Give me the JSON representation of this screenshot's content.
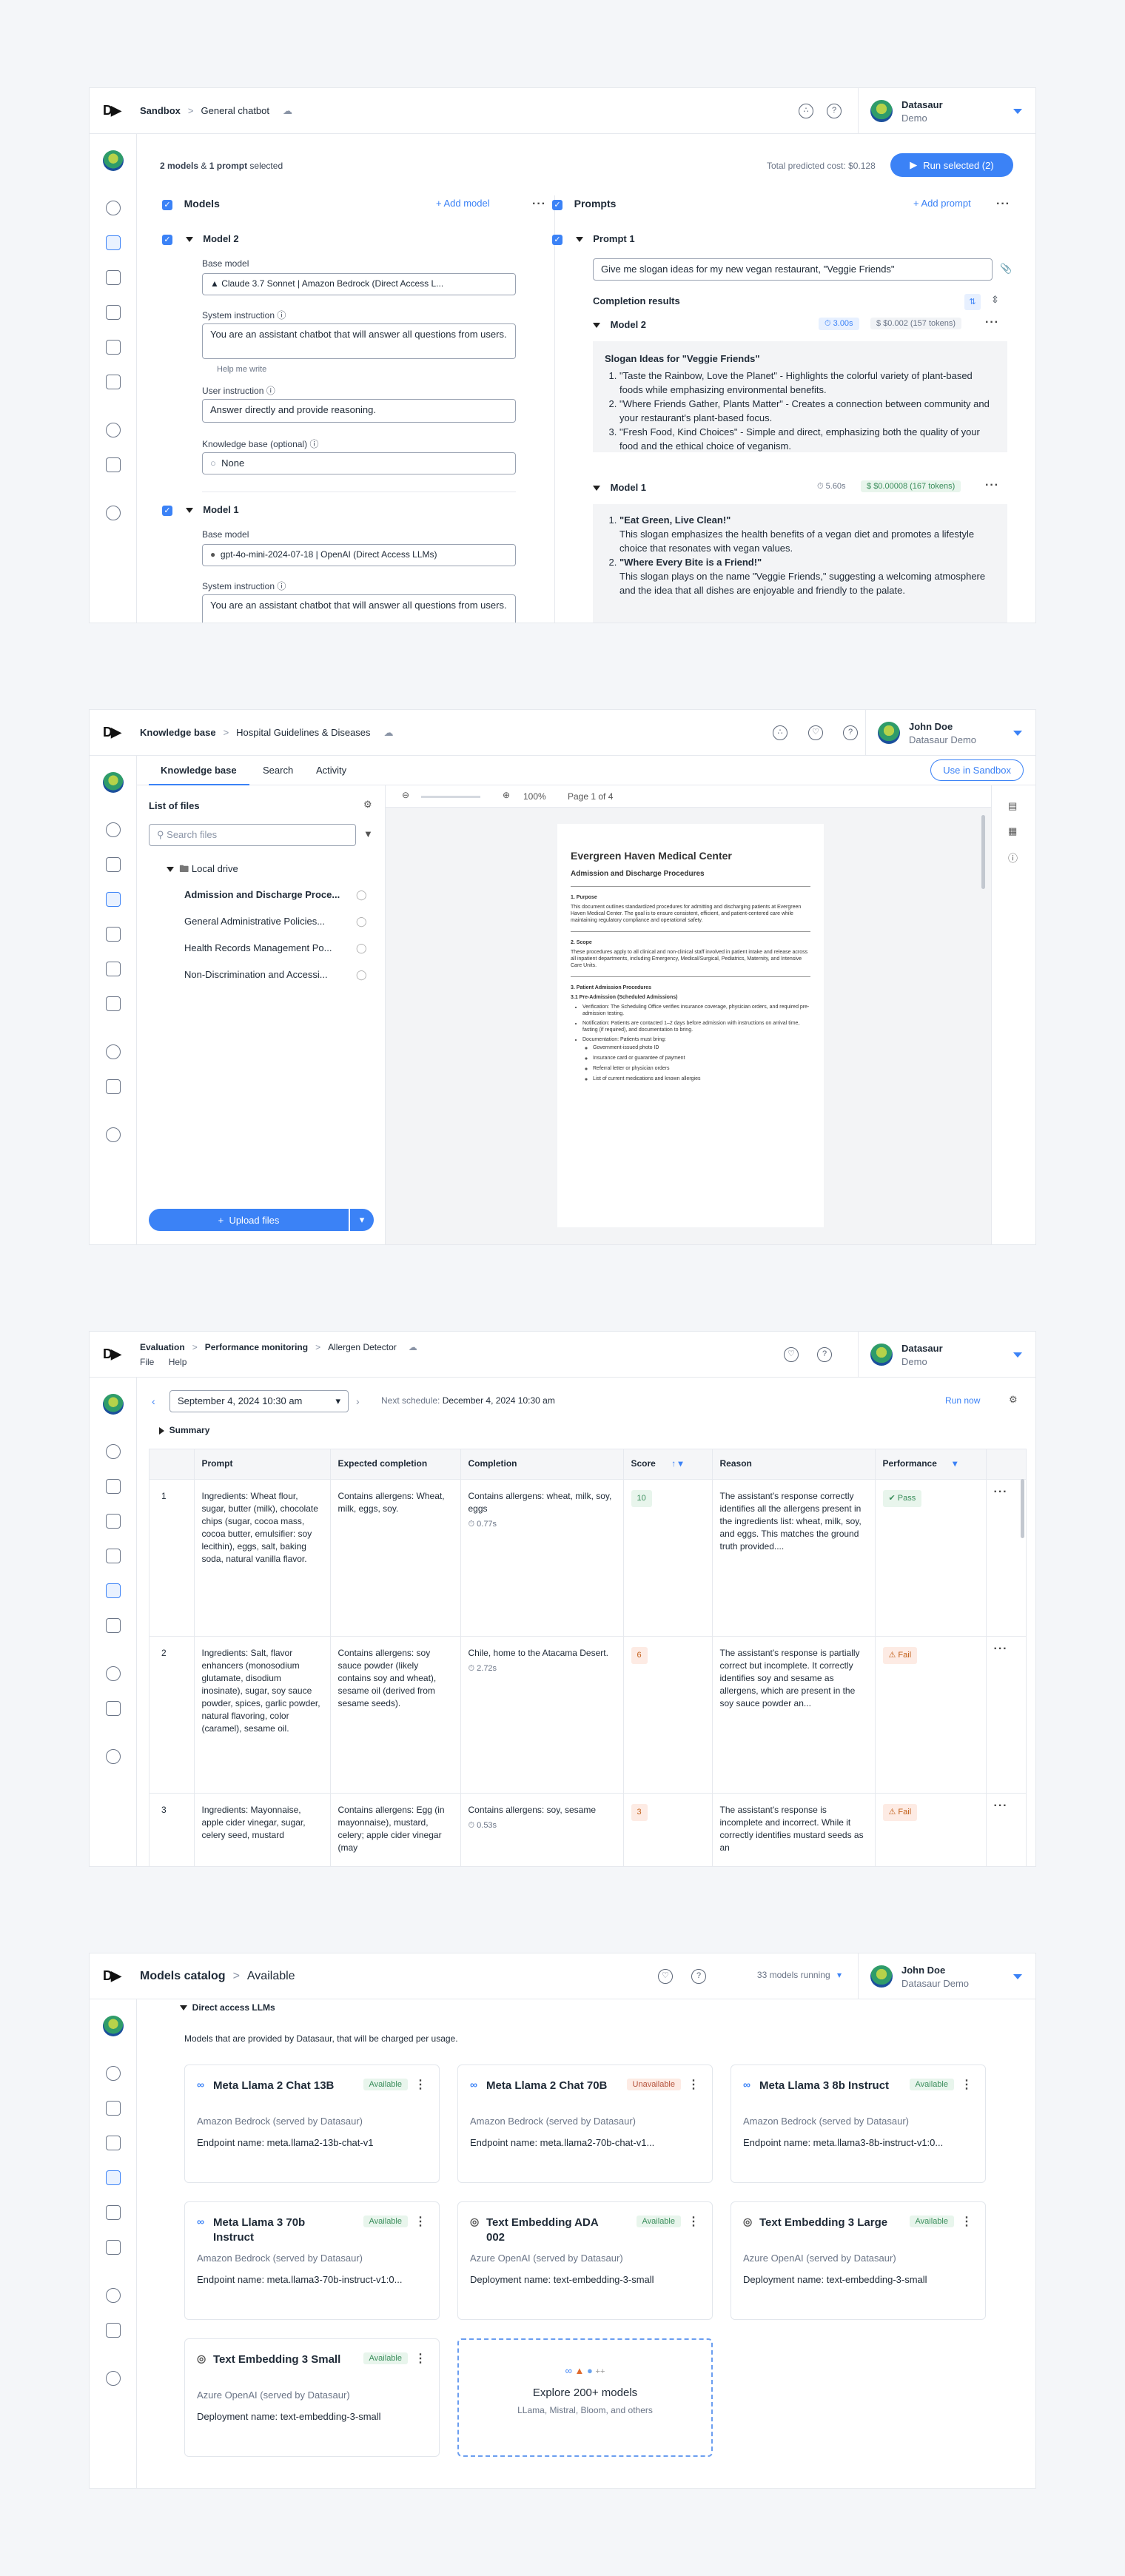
{
  "colors": {
    "accent": "#3b82f6",
    "pass": "#3a8d5b",
    "fail": "#c2601a"
  },
  "sandbox": {
    "breadcrumb": [
      "Sandbox",
      "General chatbot"
    ],
    "user": {
      "name": "Datasaur",
      "sub": "Demo"
    },
    "summary": {
      "models": "2 models",
      "amp": "&",
      "prompts": "1 prompt",
      "selected": "selected"
    },
    "cost_label": "Total predicted cost:",
    "cost_value": "$0.128",
    "run_button": "Run selected (2)",
    "models_header": "Models",
    "add_model": "+ Add model",
    "prompts_header": "Prompts",
    "add_prompt": "+ Add prompt",
    "model2": {
      "title": "Model 2",
      "base_label": "Base model",
      "base_value": "Claude 3.7 Sonnet | Amazon Bedrock (Direct Access L...",
      "sys_label": "System instruction",
      "sys_value": "You are an assistant chatbot that will answer all questions from users.",
      "help": "Help me write",
      "user_label": "User instruction",
      "user_value": "Answer directly and provide reasoning.",
      "kb_label": "Knowledge base (optional)",
      "kb_value": "None"
    },
    "model1": {
      "title": "Model 1",
      "base_label": "Base model",
      "base_value": "gpt-4o-mini-2024-07-18 | OpenAI (Direct Access LLMs)",
      "sys_label": "System instruction",
      "sys_value": "You are an assistant chatbot that will answer all questions from users."
    },
    "prompt1": {
      "title": "Prompt 1",
      "value": "Give me slogan ideas for my new vegan restaurant, \"Veggie Friends\""
    },
    "completion_results": "Completion results",
    "result2": {
      "title": "Model 2",
      "time": "3.00s",
      "cost": "$0.002 (157 tokens)",
      "heading": "Slogan Ideas for \"Veggie Friends\"",
      "items": [
        "\"Taste the Rainbow, Love the Planet\" - Highlights the colorful variety of plant-based foods while emphasizing environmental benefits.",
        "\"Where Friends Gather, Plants Matter\" - Creates a connection between community and your restaurant's plant-based focus.",
        "\"Fresh Food, Kind Choices\" - Simple and direct, emphasizing both the quality of your food and the ethical choice of veganism."
      ]
    },
    "result1": {
      "title": "Model 1",
      "time": "5.60s",
      "cost": "$0.00008 (167 tokens)",
      "items": [
        {
          "h": "\"Eat Green, Live Clean!\"",
          "d": "This slogan emphasizes the health benefits of a vegan diet and promotes a lifestyle choice that resonates with vegan values."
        },
        {
          "h": "\"Where Every Bite is a Friend!\"",
          "d": "This slogan plays on the name \"Veggie Friends,\" suggesting a welcoming atmosphere and the idea that all dishes are enjoyable and friendly to the palate."
        }
      ]
    }
  },
  "kb": {
    "breadcrumb": [
      "Knowledge base",
      "Hospital Guidelines & Diseases"
    ],
    "user": {
      "name": "John Doe",
      "sub": "Datasaur Demo"
    },
    "tabs": [
      "Knowledge base",
      "Search",
      "Activity"
    ],
    "sandbox_button": "Use in Sandbox",
    "list_title": "List of files",
    "search_placeholder": "Search files",
    "folder": "Local drive",
    "files": [
      "Admission and Discharge Proce...",
      "General Administrative Policies...",
      "Health Records Management Po...",
      "Non-Discrimination and Accessi..."
    ],
    "upload": "Upload files",
    "zoom": "100%",
    "page": "Page 1 of 4",
    "doc": {
      "title": "Evergreen Haven Medical Center",
      "subtitle": "Admission and Discharge Procedures",
      "s1": "1. Purpose",
      "s1t": "This document outlines standardized procedures for admitting and discharging patients at Evergreen Haven Medical Center. The goal is to ensure consistent, efficient, and patient-centered care while maintaining regulatory compliance and operational safety.",
      "s2": "2. Scope",
      "s2t": "These procedures apply to all clinical and non-clinical staff involved in patient intake and release across all inpatient departments, including Emergency, Medical/Surgical, Pediatrics, Maternity, and Intensive Care Units.",
      "s3": "3. Patient Admission Procedures",
      "s31": "3.1 Pre-Admission (Scheduled Admissions)",
      "b1": "Verification: The Scheduling Office verifies insurance coverage, physician orders, and required pre-admission testing.",
      "b2": "Notification: Patients are contacted 1–2 days before admission with instructions on arrival time, fasting (if required), and documentation to bring.",
      "b3": "Documentation: Patients must bring:",
      "sub": [
        "Government-issued photo ID",
        "Insurance card or guarantee of payment",
        "Referral letter or physician orders",
        "List of current medications and known allergies"
      ]
    }
  },
  "eval": {
    "breadcrumb": [
      "Evaluation",
      "Performance monitoring",
      "Allergen Detector"
    ],
    "menu": [
      "File",
      "Help"
    ],
    "user": {
      "name": "Datasaur",
      "sub": "Demo"
    },
    "date": "September 4, 2024 10:30 am",
    "next_label": "Next schedule:",
    "next_value": "December 4, 2024 10:30 am",
    "run_now": "Run now",
    "summary": "Summary",
    "columns": [
      "Prompt",
      "Expected completion",
      "Completion",
      "Score",
      "Reason",
      "Performance"
    ],
    "rows": [
      {
        "n": "1",
        "prompt": "Ingredients: Wheat flour, sugar, butter (milk), chocolate chips (sugar, cocoa mass, cocoa butter, emulsifier: soy lecithin), eggs, salt, baking soda, natural vanilla flavor.",
        "expected": "Contains allergens: Wheat, milk, eggs, soy.",
        "completion": "Contains allergens: wheat, milk, soy, eggs",
        "time": "0.77s",
        "score": "10",
        "reason": "The assistant's response correctly identifies all the allergens present in the ingredients list: wheat, milk, soy, and eggs. This matches the ground truth provided....",
        "perf": "Pass"
      },
      {
        "n": "2",
        "prompt": "Ingredients: Salt, flavor enhancers (monosodium glutamate, disodium inosinate), sugar, soy sauce powder, spices, garlic powder, natural flavoring, color (caramel), sesame oil.",
        "expected": "Contains allergens: soy sauce powder (likely contains soy and wheat), sesame oil (derived from sesame seeds).",
        "completion": "Chile, home to the Atacama Desert.",
        "time": "2.72s",
        "score": "6",
        "reason": "The assistant's response is partially correct but incomplete. It correctly identifies soy and sesame as allergens, which are present in the soy sauce powder an...",
        "perf": "Fail"
      },
      {
        "n": "3",
        "prompt": "Ingredients: Mayonnaise, apple cider vinegar, sugar, celery seed, mustard",
        "expected": "Contains allergens: Egg (in mayonnaise), mustard, celery; apple cider vinegar (may",
        "completion": "Contains allergens: soy, sesame",
        "time": "0.53s",
        "score": "3",
        "reason": "The assistant's response is incomplete and incorrect. While it correctly identifies mustard seeds as an",
        "perf": "Fail"
      }
    ]
  },
  "catalog": {
    "breadcrumb": [
      "Models catalog",
      "Available"
    ],
    "user": {
      "name": "John Doe",
      "sub": "Datasaur Demo"
    },
    "running": "33 models running",
    "section": "Direct access LLMs",
    "desc": "Models that are provided by Datasaur, that will be charged per usage.",
    "models": [
      {
        "name": "Meta Llama 2 Chat 13B",
        "status": "Available",
        "provider": "Amazon Bedrock (served by Datasaur)",
        "endpoint": "Endpoint name: meta.llama2-13b-chat-v1"
      },
      {
        "name": "Meta Llama 2 Chat 70B",
        "status": "Unavailable",
        "provider": "Amazon Bedrock (served by Datasaur)",
        "endpoint": "Endpoint name: meta.llama2-70b-chat-v1..."
      },
      {
        "name": "Meta Llama 3 8b Instruct",
        "status": "Available",
        "provider": "Amazon Bedrock (served by Datasaur)",
        "endpoint": "Endpoint name: meta.llama3-8b-instruct-v1:0..."
      },
      {
        "name": "Meta Llama 3 70b Instruct",
        "status": "Available",
        "provider": "Amazon Bedrock (served by Datasaur)",
        "endpoint": "Endpoint name: meta.llama3-70b-instruct-v1:0..."
      },
      {
        "name": "Text Embedding ADA 002",
        "status": "Available",
        "provider": "Azure OpenAI (served by Datasaur)",
        "endpoint": "Deployment name: text-embedding-3-small"
      },
      {
        "name": "Text Embedding 3 Large",
        "status": "Available",
        "provider": "Azure OpenAI (served by Datasaur)",
        "endpoint": "Deployment name: text-embedding-3-small"
      },
      {
        "name": "Text Embedding 3 Small",
        "status": "Available",
        "provider": "Azure OpenAI (served by Datasaur)",
        "endpoint": "Deployment name: text-embedding-3-small"
      }
    ],
    "explore_title": "Explore 200+ models",
    "explore_sub": "LLama, Mistral, Bloom, and others",
    "explore_more": "++"
  }
}
